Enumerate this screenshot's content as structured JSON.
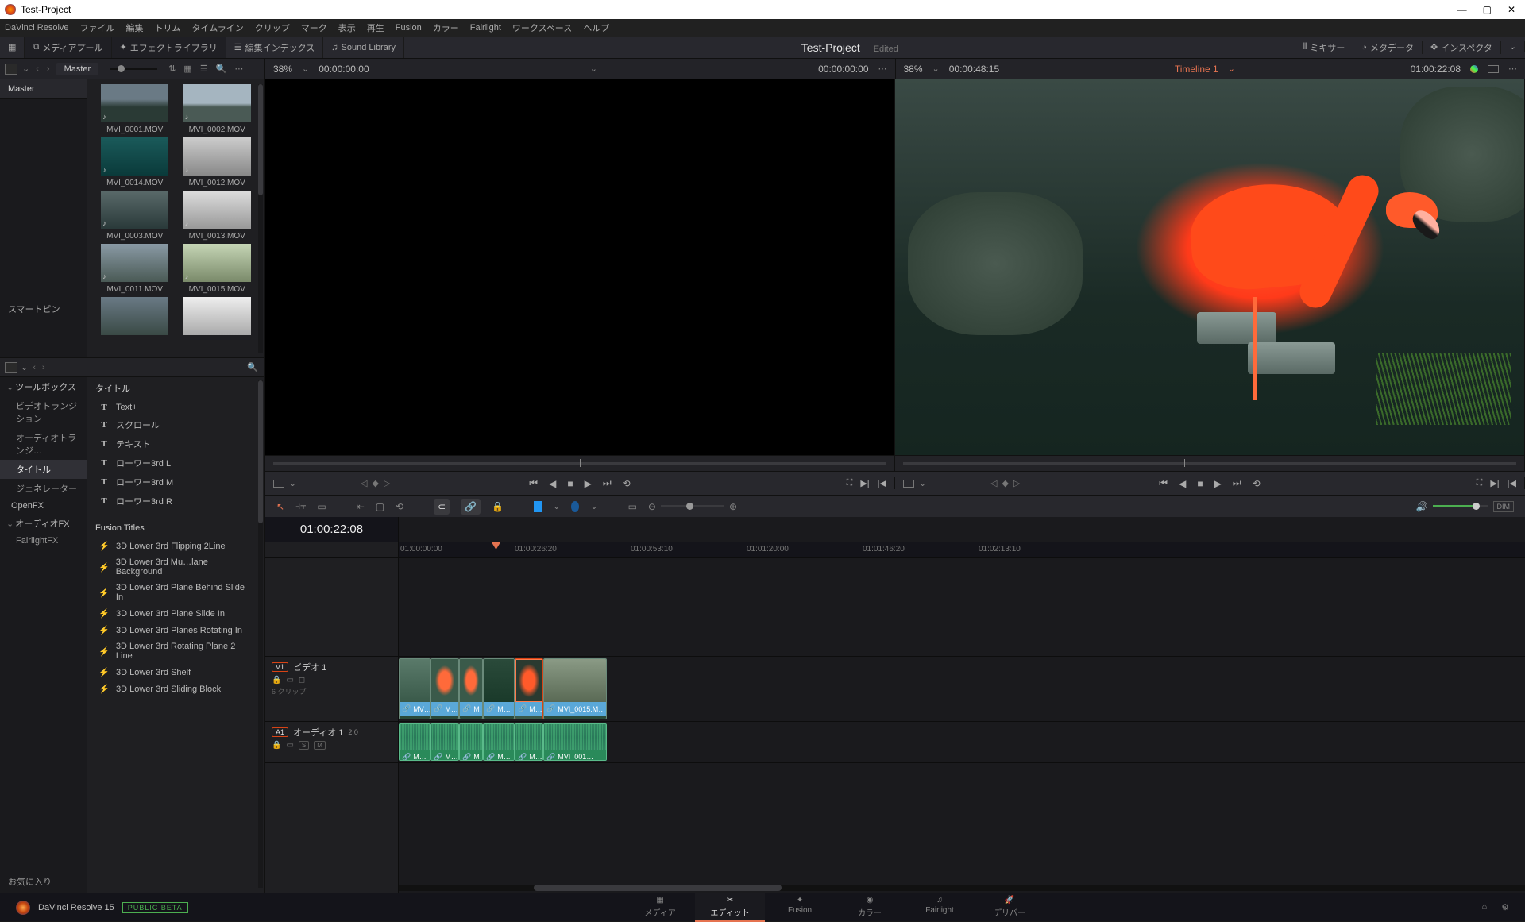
{
  "window": {
    "title": "Test-Project"
  },
  "menubar": [
    "DaVinci Resolve",
    "ファイル",
    "編集",
    "トリム",
    "タイムライン",
    "クリップ",
    "マーク",
    "表示",
    "再生",
    "Fusion",
    "カラー",
    "Fairlight",
    "ワークスペース",
    "ヘルプ"
  ],
  "toolbar": {
    "media_pool": "メディアプール",
    "effects_lib": "エフェクトライブラリ",
    "edit_index": "編集インデックス",
    "sound_lib": "Sound Library",
    "project": "Test-Project",
    "status": "Edited",
    "mixer": "ミキサー",
    "metadata": "メタデータ",
    "inspector": "インスペクタ"
  },
  "breadcrumb": {
    "root": "Master"
  },
  "mediapool": {
    "bins": {
      "master": "Master",
      "smart": "スマートビン"
    },
    "clips": [
      {
        "name": "MVI_0001.MOV"
      },
      {
        "name": "MVI_0002.MOV"
      },
      {
        "name": "MVI_0014.MOV"
      },
      {
        "name": "MVI_0012.MOV"
      },
      {
        "name": "MVI_0003.MOV"
      },
      {
        "name": "MVI_0013.MOV"
      },
      {
        "name": "MVI_0011.MOV"
      },
      {
        "name": "MVI_0015.MOV"
      }
    ]
  },
  "source_viewer": {
    "zoom": "38%",
    "tc_left": "00:00:00:00",
    "tc_right": "00:00:00:00"
  },
  "program_viewer": {
    "zoom": "38%",
    "tc_left": "00:00:48:15",
    "timeline_name": "Timeline 1",
    "tc_right": "01:00:22:08"
  },
  "fx": {
    "categories": {
      "toolbox": "ツールボックス",
      "video_trans": "ビデオトランジション",
      "audio_trans": "オーディオトランジ…",
      "titles": "タイトル",
      "generators": "ジェネレーター",
      "openfx": "OpenFX",
      "audiofx": "オーディオFX",
      "fairlightfx": "FairlightFX",
      "favorites": "お気に入り"
    },
    "section_titles": "タイトル",
    "titles": [
      "Text+",
      "スクロール",
      "テキスト",
      "ローワー3rd L",
      "ローワー3rd M",
      "ローワー3rd R"
    ],
    "fusion_header": "Fusion Titles",
    "fusion": [
      "3D Lower 3rd Flipping 2Line",
      "3D Lower 3rd Mu…lane Background",
      "3D Lower 3rd Plane Behind Slide In",
      "3D Lower 3rd Plane Slide In",
      "3D Lower 3rd Planes Rotating In",
      "3D Lower 3rd Rotating Plane 2 Line",
      "3D Lower 3rd Shelf",
      "3D Lower 3rd Sliding Block"
    ]
  },
  "timeline": {
    "current_tc": "01:00:22:08",
    "ruler": [
      "01:00:00:00",
      "01:00:26:20",
      "01:00:53:10",
      "01:01:20:00",
      "01:01:46:20",
      "01:02:13:10"
    ],
    "video_track": {
      "badge": "V1",
      "name": "ビデオ 1",
      "clip_count": "6 クリップ"
    },
    "audio_track": {
      "badge": "A1",
      "name": "オーディオ 1",
      "ch": "2.0",
      "s": "S",
      "m": "M"
    },
    "v_clips": [
      {
        "label": "MV…"
      },
      {
        "label": "M…"
      },
      {
        "label": "M…"
      },
      {
        "label": "M…"
      },
      {
        "label": "M…"
      },
      {
        "label": "MVI_0015.M…"
      }
    ],
    "a_clips": [
      {
        "label": "M…"
      },
      {
        "label": "M…"
      },
      {
        "label": "M…"
      },
      {
        "label": "M…"
      },
      {
        "label": "M…"
      },
      {
        "label": "MVI_001…"
      }
    ],
    "dim": "DIM"
  },
  "pagebar": {
    "app": "DaVinci Resolve 15",
    "beta": "PUBLIC BETA",
    "tabs": {
      "media": "メディア",
      "edit": "エディット",
      "fusion": "Fusion",
      "color": "カラー",
      "fairlight": "Fairlight",
      "deliver": "デリバー"
    }
  }
}
